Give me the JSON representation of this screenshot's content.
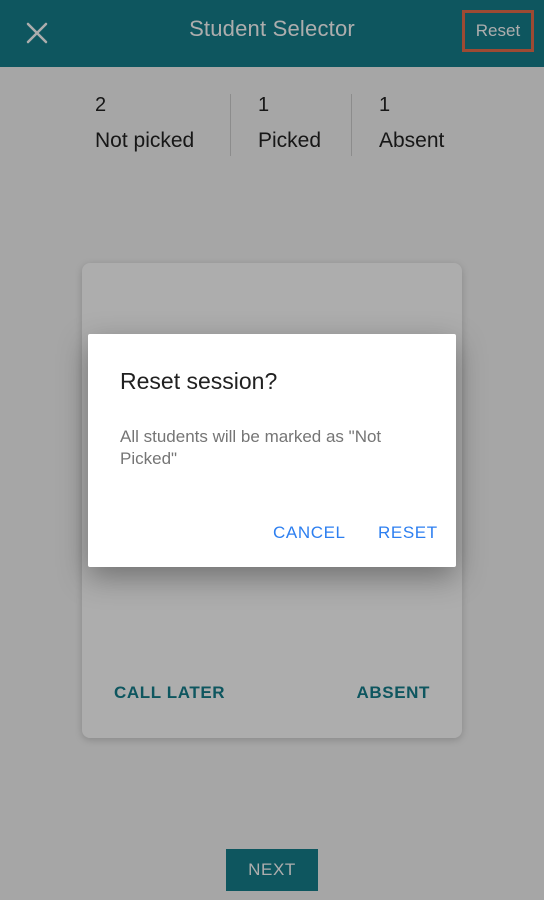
{
  "appbar": {
    "close_icon": "close-icon",
    "title": "Student Selector",
    "reset_label": "Reset"
  },
  "stats": [
    {
      "count": "2",
      "label": "Not picked"
    },
    {
      "count": "1",
      "label": "Picked"
    },
    {
      "count": "1",
      "label": "Absent"
    }
  ],
  "card": {
    "call_later_label": "CALL LATER",
    "absent_label": "ABSENT"
  },
  "next_label": "NEXT",
  "dialog": {
    "title": "Reset session?",
    "message": "All students will be marked as \"Not Picked\"",
    "cancel_label": "CANCEL",
    "reset_label": "RESET"
  },
  "colors": {
    "primary": "#167f8d",
    "highlight_border": "#e86e4c",
    "dialog_action": "#2d7ff0"
  }
}
